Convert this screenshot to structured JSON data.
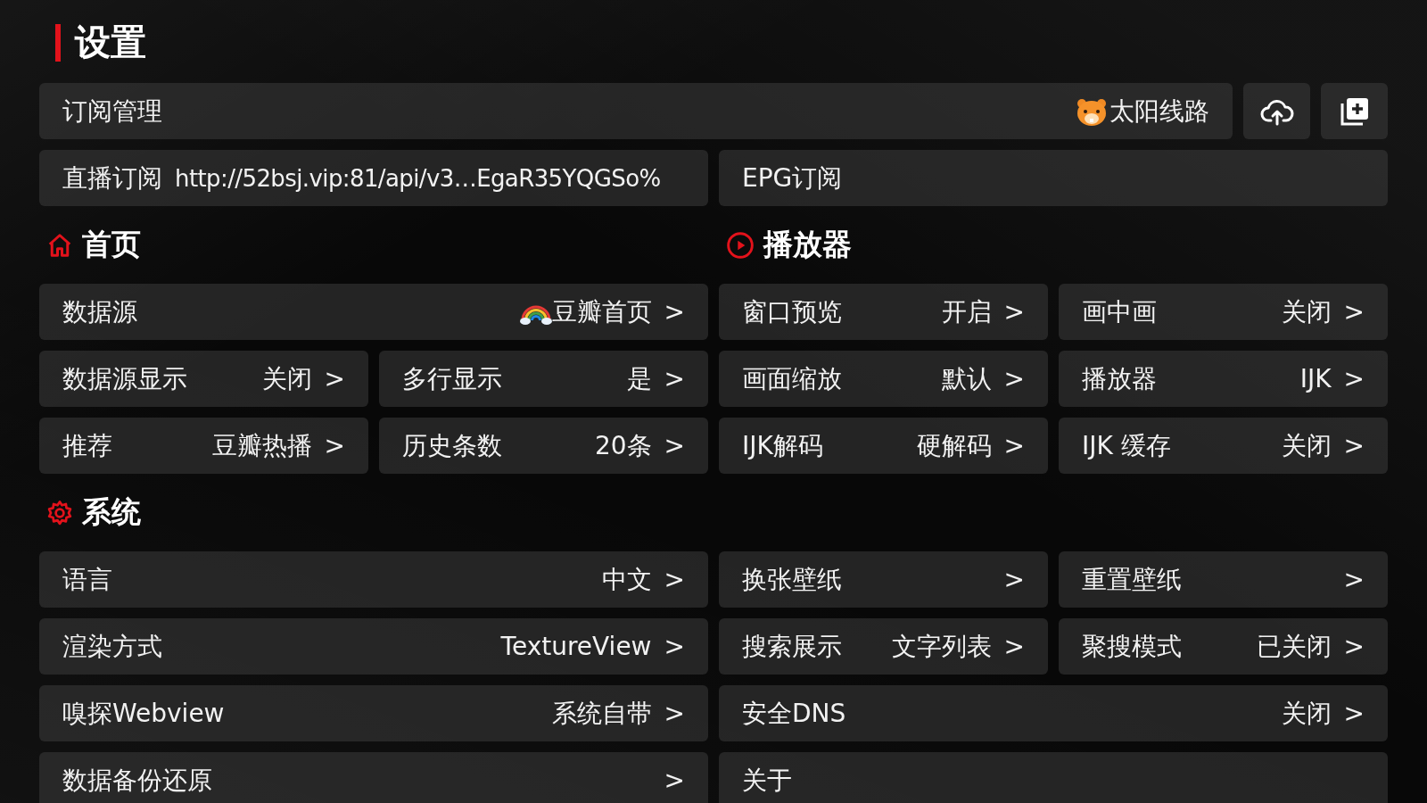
{
  "title": "设置",
  "subscription": {
    "label": "订阅管理",
    "source": "太阳线路",
    "buttons": [
      {
        "kind": "upload"
      },
      {
        "kind": "add"
      }
    ]
  },
  "live": {
    "label": "直播订阅",
    "url": "http://52bsj.vip:81/api/v3…EgaR35YQGSo%"
  },
  "epg": {
    "label": "EPG订阅"
  },
  "home": {
    "title": "首页",
    "items": [
      {
        "label": "数据源",
        "value": "豆瓣首页",
        "chevron": ">"
      },
      {
        "label": "数据源显示",
        "value": "关闭",
        "chevron": ">"
      },
      {
        "label": "多行显示",
        "value": "是",
        "chevron": ">"
      },
      {
        "label": "推荐",
        "value": "豆瓣热播",
        "chevron": ">"
      },
      {
        "label": "历史条数",
        "value": "20条",
        "chevron": ">"
      }
    ]
  },
  "player": {
    "title": "播放器",
    "items": [
      {
        "label": "窗口预览",
        "value": "开启",
        "chevron": ">"
      },
      {
        "label": "画中画",
        "value": "关闭",
        "chevron": ">"
      },
      {
        "label": "画面缩放",
        "value": "默认",
        "chevron": ">"
      },
      {
        "label": "播放器",
        "value": "IJK",
        "chevron": ">"
      },
      {
        "label": "IJK解码",
        "value": "硬解码",
        "chevron": ">"
      },
      {
        "label": "IJK 缓存",
        "value": "关闭",
        "chevron": ">"
      }
    ]
  },
  "system": {
    "title": "系统",
    "items": [
      {
        "label": "语言",
        "value": "中文",
        "chevron": ">"
      },
      {
        "label": "换张壁纸",
        "chevron": ">"
      },
      {
        "label": "重置壁纸",
        "chevron": ">"
      },
      {
        "label": "渲染方式",
        "value": "TextureView",
        "chevron": ">"
      },
      {
        "label": "搜索展示",
        "value": "文字列表",
        "chevron": ">"
      },
      {
        "label": "聚搜模式",
        "value": "已关闭",
        "chevron": ">"
      },
      {
        "label": "嗅探Webview",
        "value": "系统自带",
        "chevron": ">"
      },
      {
        "label": "安全DNS",
        "value": "关闭",
        "chevron": ">"
      },
      {
        "label": "数据备份还原",
        "chevron": ">"
      },
      {
        "label": "关于"
      }
    ]
  }
}
